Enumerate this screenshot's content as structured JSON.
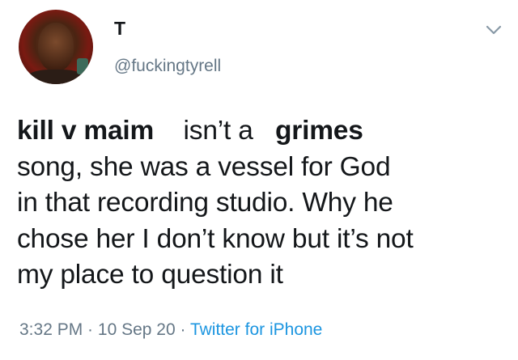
{
  "tweet": {
    "author": {
      "display_name": "T",
      "handle": "@fuckingtyrell"
    },
    "text_lines": [
      {
        "segments": [
          {
            "text": "kill v maim",
            "bold": true
          },
          {
            "text": "    isn’t a   ",
            "bold": false
          },
          {
            "text": "grimes",
            "bold": true
          }
        ]
      },
      {
        "segments": [
          {
            "text": "song, she was a vessel for God",
            "bold": false
          }
        ]
      },
      {
        "segments": [
          {
            "text": "in that recording studio. Why he",
            "bold": false
          }
        ]
      },
      {
        "segments": [
          {
            "text": "chose her I don’t know but it’s not",
            "bold": false
          }
        ]
      },
      {
        "segments": [
          {
            "text": "my place to question it",
            "bold": false
          }
        ]
      }
    ],
    "meta": {
      "time": "3:32 PM",
      "separator1": " · ",
      "date": "10 Sep 20",
      "separator2": " · ",
      "source": "Twitter for iPhone"
    }
  },
  "icons": {
    "menu": "chevron-down-icon",
    "avatar": "profile-photo"
  },
  "colors": {
    "text": "#14171a",
    "secondary": "#657786",
    "link": "#1b95e0"
  }
}
